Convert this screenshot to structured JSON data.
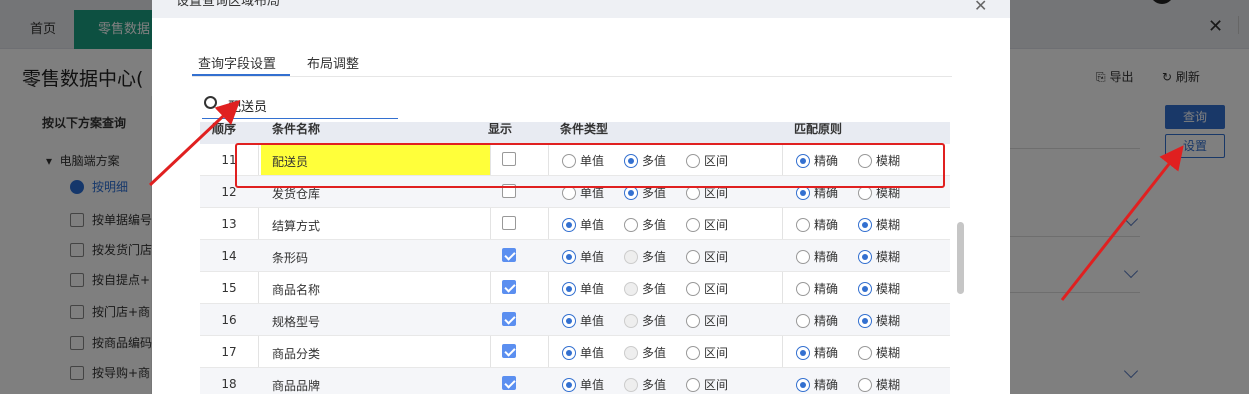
{
  "background": {
    "tabs": {
      "home": "首页",
      "active": "零售数据"
    },
    "page_title": "零售数据中心(",
    "toolbar": {
      "export": "导出",
      "refresh": "刷新"
    },
    "sidebar": {
      "heading": "按以下方案查询",
      "group": "电脑端方案",
      "items": [
        "按明细",
        "按单据编号",
        "按发货门店",
        "按自提点+",
        "按门店+商",
        "按商品编码",
        "按导购+商"
      ]
    },
    "buttons": {
      "query": "查询",
      "setting": "设置"
    }
  },
  "modal": {
    "title": "设置查询区域布局",
    "tabs": [
      "查询字段设置",
      "布局调整"
    ],
    "search": {
      "value": "配送员"
    },
    "columns": [
      "顺序",
      "条件名称",
      "显示",
      "条件类型",
      "匹配原则"
    ],
    "radio_labels": {
      "single": "单值",
      "multi": "多值",
      "range": "区间",
      "exact": "精确",
      "fuzzy": "模糊"
    },
    "rows": [
      {
        "idx": "11",
        "name": "配送员",
        "show": false,
        "type": "multi",
        "match": "exact",
        "highlight": true
      },
      {
        "idx": "12",
        "name": "发货仓库",
        "show": false,
        "type": "multi",
        "match": "exact"
      },
      {
        "idx": "13",
        "name": "结算方式",
        "show": false,
        "type": "single",
        "match": "fuzzy"
      },
      {
        "idx": "14",
        "name": "条形码",
        "show": true,
        "type": "single",
        "match": "fuzzy"
      },
      {
        "idx": "15",
        "name": "商品名称",
        "show": true,
        "type": "single",
        "match": "fuzzy"
      },
      {
        "idx": "16",
        "name": "规格型号",
        "show": true,
        "type": "single",
        "match": "fuzzy"
      },
      {
        "idx": "17",
        "name": "商品分类",
        "show": true,
        "type": "single",
        "match": "exact"
      },
      {
        "idx": "18",
        "name": "商品品牌",
        "show": true,
        "type": "single",
        "match": "exact"
      }
    ]
  },
  "colors": {
    "accent": "#3370d0",
    "highlight": "#ffff3a",
    "annotation": "#e02020"
  }
}
